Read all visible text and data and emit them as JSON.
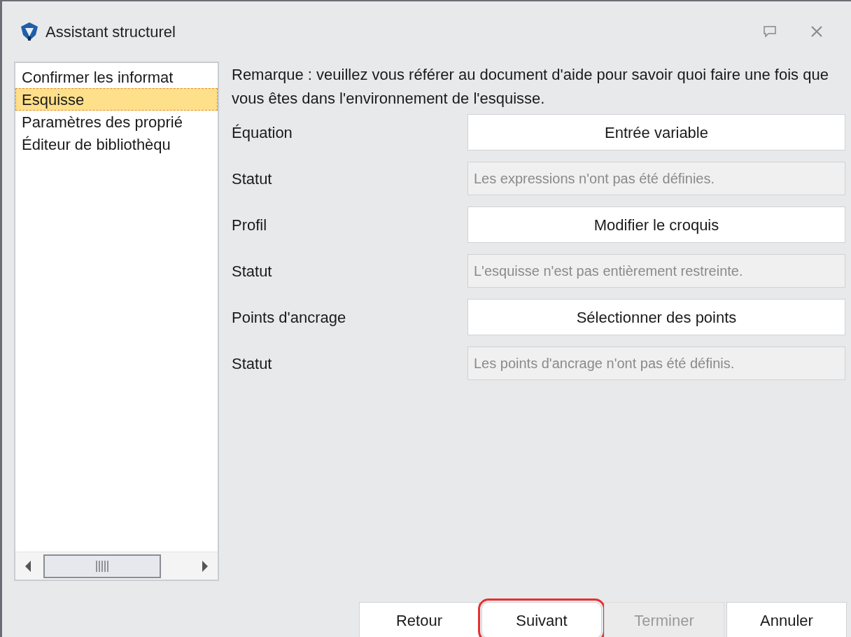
{
  "window": {
    "title": "Assistant structurel"
  },
  "steps": [
    {
      "label": "Confirmer les informat",
      "selected": false
    },
    {
      "label": "Esquisse",
      "selected": true
    },
    {
      "label": "Paramètres des proprié",
      "selected": false
    },
    {
      "label": "Éditeur de bibliothèqu",
      "selected": false
    }
  ],
  "note": "Remarque : veuillez vous référer au document d'aide pour savoir quoi faire une fois que vous êtes dans l'environnement de l'esquisse.",
  "rows": [
    {
      "kind": "button",
      "label": "Équation",
      "value": "Entrée variable"
    },
    {
      "kind": "status",
      "label": "Statut",
      "value": "Les expressions n'ont pas été définies."
    },
    {
      "kind": "button",
      "label": "Profil",
      "value": "Modifier le croquis"
    },
    {
      "kind": "status",
      "label": "Statut",
      "value": "L'esquisse n'est pas entièrement restreinte."
    },
    {
      "kind": "button",
      "label": "Points d'ancrage",
      "value": "Sélectionner des points"
    },
    {
      "kind": "status",
      "label": "Statut",
      "value": "Les points d'ancrage n'ont pas été définis."
    }
  ],
  "buttons": [
    {
      "label": "Retour",
      "disabled": false,
      "highlighted": false
    },
    {
      "label": "Suivant",
      "disabled": false,
      "highlighted": true
    },
    {
      "label": "Terminer",
      "disabled": true,
      "highlighted": false
    },
    {
      "label": "Annuler",
      "disabled": false,
      "highlighted": false
    }
  ]
}
